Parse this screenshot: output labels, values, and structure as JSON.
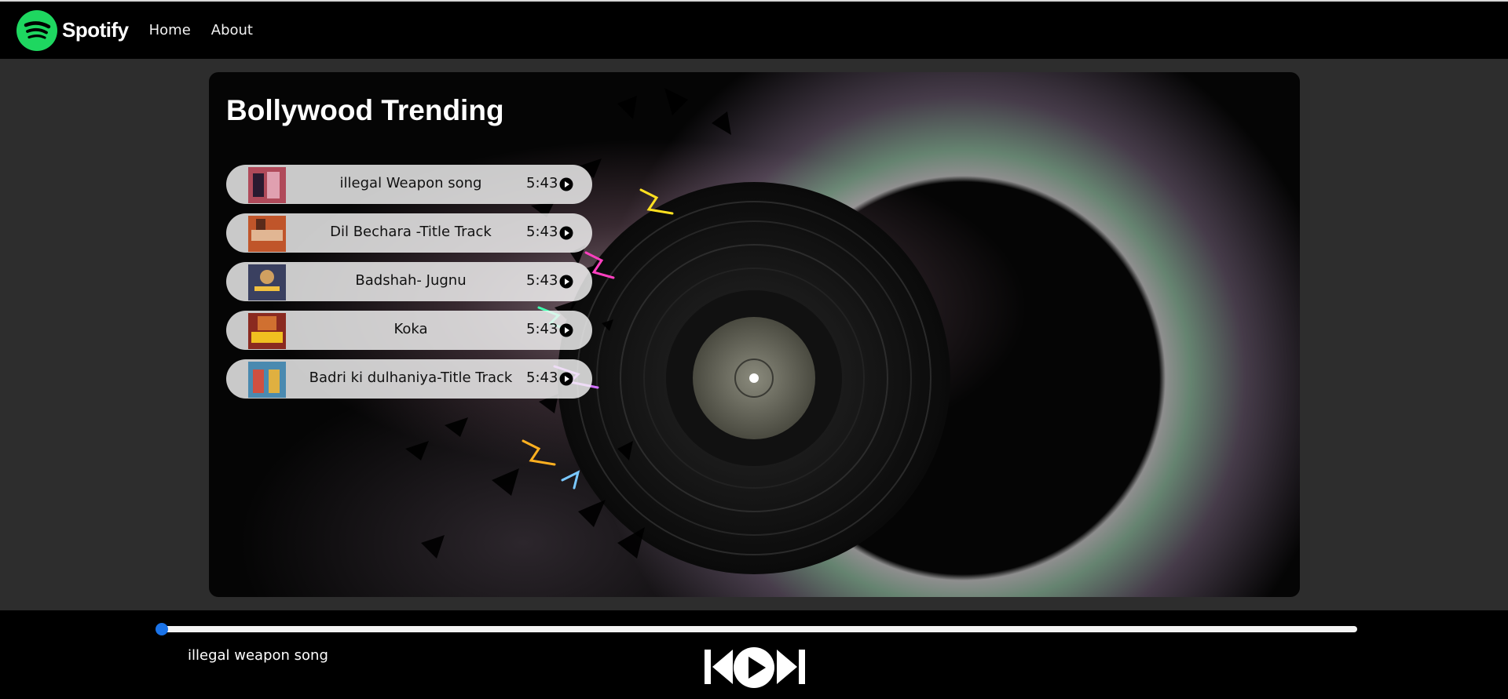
{
  "navbar": {
    "brand": "Spotify",
    "links": [
      {
        "label": "Home"
      },
      {
        "label": "About"
      }
    ],
    "logo_icon": "spotify-logo-icon"
  },
  "hero": {
    "title": "Bollywood Trending",
    "songs": [
      {
        "name": "illegal Weapon song",
        "duration": "5:43",
        "thumb_color": "#b04a5a"
      },
      {
        "name": "Dil Bechara -Title Track",
        "duration": "5:43",
        "thumb_color": "#c0552a"
      },
      {
        "name": "Badshah- Jugnu",
        "duration": "5:43",
        "thumb_color": "#3a4060"
      },
      {
        "name": "Koka",
        "duration": "5:43",
        "thumb_color": "#d8a018"
      },
      {
        "name": "Badri ki dulhaniya-Title Track",
        "duration": "5:43",
        "thumb_color": "#4a8ab0"
      }
    ]
  },
  "player": {
    "now_playing": "illegal weapon song",
    "progress": 0.0,
    "accent_color": "#1a73e8",
    "controls": [
      "previous-icon",
      "play-icon",
      "next-icon"
    ]
  },
  "colors": {
    "brand_green": "#1ed760",
    "navbar_bg": "#000000",
    "page_bg": "#2d2d2d"
  }
}
